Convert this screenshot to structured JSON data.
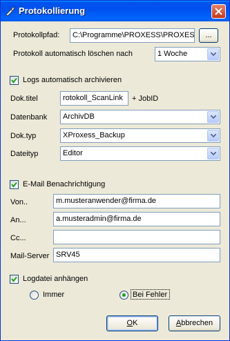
{
  "window": {
    "title": "Protokollierung"
  },
  "protokoll": {
    "pfad_label": "Protokollpfad:",
    "pfad_value": "C:\\Programme\\PROXESS\\PROXESS",
    "browse_label": "...",
    "auto_delete_label": "Protokoll automatisch löschen nach",
    "auto_delete_value": "1 Woche"
  },
  "archiv": {
    "checkbox_label": "Logs automatisch archivieren",
    "checked": true,
    "doktitel_label": "Dok.titel",
    "doktitel_value": "rotokoll_ScanLink",
    "jobid_label": "+ JobID",
    "datenbank_label": "Datenbank",
    "datenbank_value": "ArchivDB",
    "doktyp_label": "Dok.typ",
    "doktyp_value": "XProxess_Backup",
    "dateityp_label": "Dateityp",
    "dateityp_value": "Editor"
  },
  "email": {
    "checkbox_label": "E-Mail Benachrichtigung",
    "checked": true,
    "von_label": "Von..",
    "von_value": "m.musteranwender@firma.de",
    "an_label": "An...",
    "an_value": "a.musteradmin@firma.de",
    "cc_label": "Cc...",
    "cc_value": "",
    "server_label": "Mail-Server",
    "server_value": "SRV45"
  },
  "logdatei": {
    "checkbox_label": "Logdatei anhängen",
    "checked": true,
    "option_immer": "Immer",
    "option_fehler": "Bei Fehler",
    "selected": "Bei Fehler"
  },
  "buttons": {
    "ok": "OK",
    "ok_mnemonic": "O",
    "ok_rest": "K",
    "cancel": "Abbrechen",
    "cancel_mnemonic": "A",
    "cancel_rest": "bbrechen"
  },
  "colors": {
    "titlebar": "#0053ee",
    "dialog_bg": "#ece9d8",
    "field_border": "#7f9db9",
    "check_green": "#21a121"
  }
}
